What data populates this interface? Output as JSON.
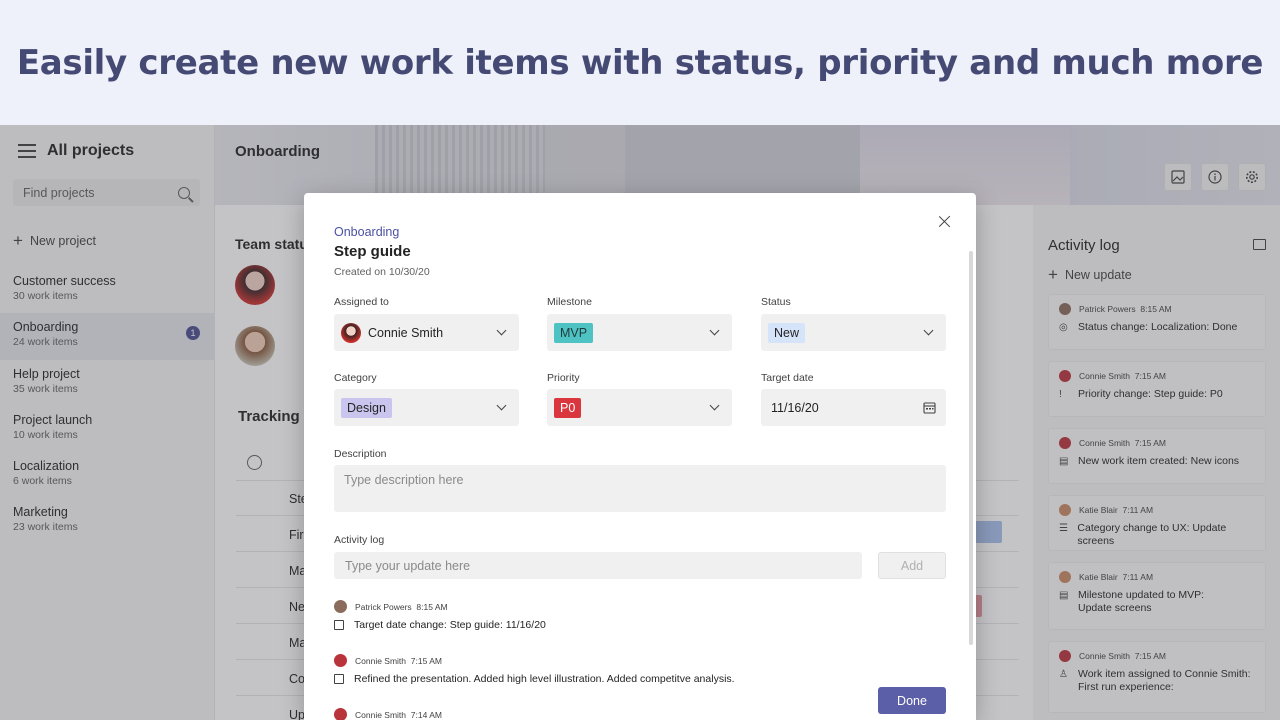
{
  "hero": {
    "headline": "Easily create new work items with status, priority and much more"
  },
  "sidebar": {
    "title": "All projects",
    "search_placeholder": "Find projects",
    "new_project": "New project",
    "projects": [
      {
        "name": "Customer success",
        "count": "30 work items"
      },
      {
        "name": "Onboarding",
        "count": "24 work items",
        "badge": "1"
      },
      {
        "name": "Help project",
        "count": "35 work items"
      },
      {
        "name": "Project launch",
        "count": "10 work items"
      },
      {
        "name": "Localization",
        "count": "6 work items"
      },
      {
        "name": "Marketing",
        "count": "23 work items"
      }
    ]
  },
  "main": {
    "title": "Onboarding",
    "team_status": "Team statu",
    "tracking": "Tracking",
    "row_fragments": [
      "Ste",
      "Firs",
      "Ma",
      "Ne",
      "Ma",
      "Co",
      "Up"
    ]
  },
  "activity_log": {
    "title": "Activity log",
    "new_update": "New update",
    "entries": [
      {
        "who": "Patrick Powers",
        "time": "8:15 AM",
        "text": "Status change: Localization: Done"
      },
      {
        "who": "Connie Smith",
        "time": "7:15 AM",
        "text": "Priority change: Step guide: P0"
      },
      {
        "who": "Connie Smith",
        "time": "7:15 AM",
        "text": "New work item created: New icons"
      },
      {
        "who": "Katie Blair",
        "time": "7:11 AM",
        "text": "Category change to UX: Update screens"
      },
      {
        "who": "Katie Blair",
        "time": "7:11 AM",
        "text": "Milestone updated to MVP:",
        "text2": "Update screens"
      },
      {
        "who": "Connie Smith",
        "time": "7:15 AM",
        "text": "Work item assigned to Connie Smith:",
        "text2": "First run experience:"
      }
    ]
  },
  "dialog": {
    "project": "Onboarding",
    "title": "Step guide",
    "created": "Created on 10/30/20",
    "assigned_label": "Assigned to",
    "assigned_value": "Connie Smith",
    "milestone_label": "Milestone",
    "milestone_value": "MVP",
    "status_label": "Status",
    "status_value": "New",
    "category_label": "Category",
    "category_value": "Design",
    "priority_label": "Priority",
    "priority_value": "P0",
    "target_label": "Target date",
    "target_value": "11/16/20",
    "description_label": "Description",
    "description_placeholder": "Type description here",
    "activity_label": "Activity log",
    "update_placeholder": "Type your update here",
    "add_button": "Add",
    "done_button": "Done",
    "log": [
      {
        "who": "Patrick Powers",
        "time": "8:15 AM",
        "text": "Target date change: Step guide: 11/16/20"
      },
      {
        "who": "Connie Smith",
        "time": "7:15 AM",
        "text": "Refined the presentation. Added high level illustration. Added competitve analysis."
      },
      {
        "who": "Connie Smith",
        "time": "7:14 AM",
        "text": ""
      }
    ]
  },
  "colors": {
    "accent": "#5b5fa8",
    "milestone_tag": "#4fc3c3",
    "status_tag": "#d6e4fa",
    "category_tag": "#c9c5ee",
    "priority_tag": "#d9363e"
  }
}
